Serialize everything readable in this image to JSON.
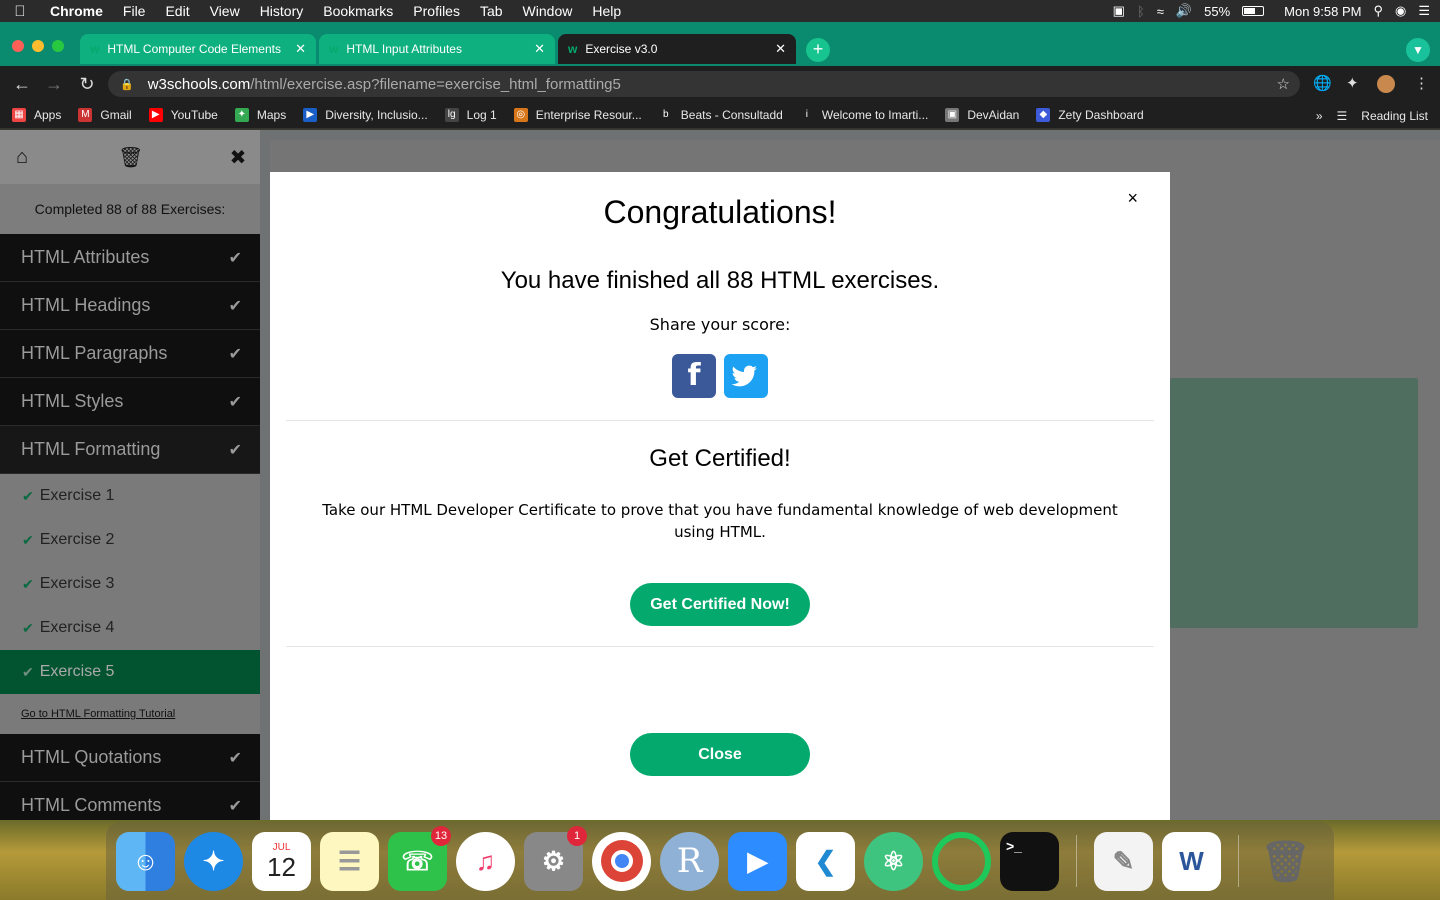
{
  "menubar": {
    "app": "Chrome",
    "items": [
      "File",
      "Edit",
      "View",
      "History",
      "Bookmarks",
      "Profiles",
      "Tab",
      "Window",
      "Help"
    ],
    "battery": "55%",
    "clock": "Mon 9:58 PM"
  },
  "tabs": [
    {
      "label": "HTML Computer Code Elements"
    },
    {
      "label": "HTML Input Attributes"
    },
    {
      "label": "Exercise v3.0"
    }
  ],
  "address": {
    "host": "w3schools.com",
    "path": "/html/exercise.asp?filename=exercise_html_formatting5"
  },
  "bookmarks": [
    {
      "label": "Apps"
    },
    {
      "label": "Gmail"
    },
    {
      "label": "YouTube"
    },
    {
      "label": "Maps"
    },
    {
      "label": "Diversity, Inclusio..."
    },
    {
      "label": "Log 1"
    },
    {
      "label": "Enterprise Resour..."
    },
    {
      "label": "Beats - Consultadd"
    },
    {
      "label": "Welcome to Imarti..."
    },
    {
      "label": "DevAidan"
    },
    {
      "label": "Zety Dashboard"
    }
  ],
  "reading_list": "Reading List",
  "sidebar": {
    "completed": "Completed 88 of 88 Exercises:",
    "sections": [
      "HTML Attributes",
      "HTML Headings",
      "HTML Paragraphs",
      "HTML Styles",
      "HTML Formatting"
    ],
    "exercises": [
      "Exercise 1",
      "Exercise 2",
      "Exercise 3",
      "Exercise 4",
      "Exercise 5"
    ],
    "tutorial_link": "Go to HTML Formatting Tutorial",
    "sections_after": [
      "HTML Quotations",
      "HTML Comments"
    ]
  },
  "modal": {
    "close_x": "×",
    "title": "Congratulations!",
    "finished": "You have finished all 88 HTML exercises.",
    "share": "Share your score:",
    "cert_title": "Get Certified!",
    "cert_desc": "Take our HTML Developer Certificate to prove that you have fundamental knowledge of web development using HTML.",
    "cert_button": "Get Certified Now!",
    "close_button": "Close"
  },
  "dock": {
    "calendar_month": "JUL",
    "calendar_day": "12",
    "facetime_badge": "13",
    "settings_badge": "1",
    "r_label": "R"
  },
  "colors": {
    "w3_green": "#04aa6d",
    "facebook": "#3b5998",
    "twitter": "#1da1f2",
    "badge_red": "#e0263a"
  }
}
